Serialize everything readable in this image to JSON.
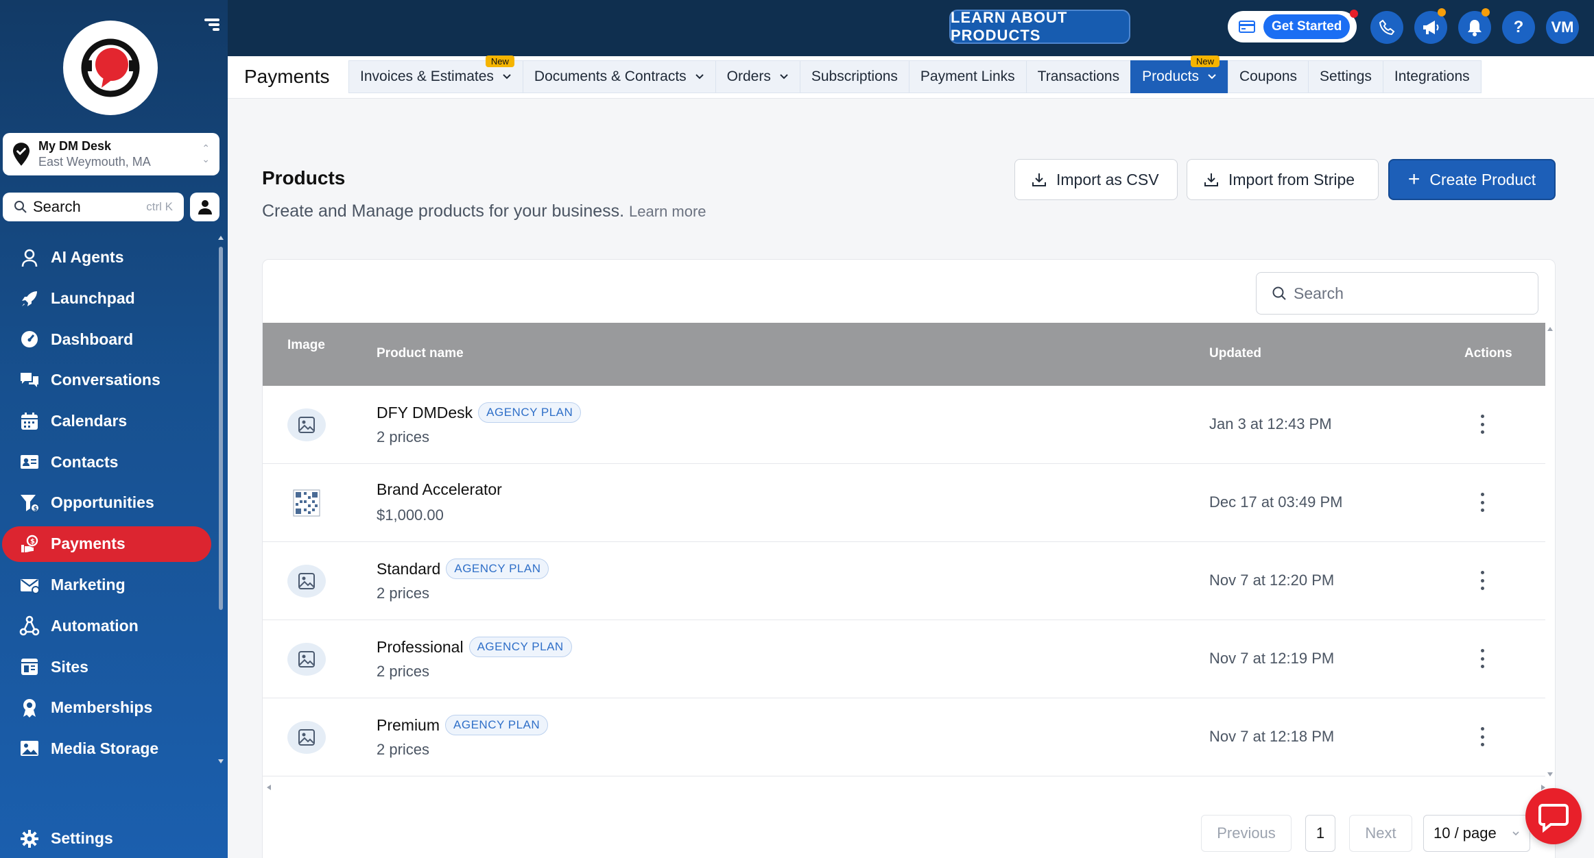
{
  "sidebar": {
    "location": {
      "name": "My DM Desk",
      "address": "East Weymouth, MA"
    },
    "search": {
      "label": "Search",
      "shortcut": "ctrl K"
    },
    "items": [
      {
        "label": "AI Agents",
        "icon": "ai-agent-icon"
      },
      {
        "label": "Launchpad",
        "icon": "rocket-icon"
      },
      {
        "label": "Dashboard",
        "icon": "gauge-icon"
      },
      {
        "label": "Conversations",
        "icon": "chat-bubbles-icon"
      },
      {
        "label": "Calendars",
        "icon": "calendar-icon"
      },
      {
        "label": "Contacts",
        "icon": "contact-card-icon"
      },
      {
        "label": "Opportunities",
        "icon": "funnel-icon"
      },
      {
        "label": "Payments",
        "icon": "payments-icon",
        "active": true
      },
      {
        "label": "Marketing",
        "icon": "envelope-icon"
      },
      {
        "label": "Automation",
        "icon": "workflow-icon"
      },
      {
        "label": "Sites",
        "icon": "sites-icon"
      },
      {
        "label": "Memberships",
        "icon": "badge-icon"
      },
      {
        "label": "Media Storage",
        "icon": "image-icon"
      }
    ],
    "settings": {
      "label": "Settings",
      "icon": "gear-icon"
    }
  },
  "topbar": {
    "learn_label": "LEARN ABOUT PRODUCTS",
    "get_started_label": "Get Started",
    "avatar_initials": "VM",
    "help_label": "?"
  },
  "subnav": {
    "title": "Payments",
    "tabs": [
      {
        "label": "Invoices & Estimates",
        "dropdown": true,
        "badge": "New"
      },
      {
        "label": "Documents & Contracts",
        "dropdown": true
      },
      {
        "label": "Orders",
        "dropdown": true
      },
      {
        "label": "Subscriptions"
      },
      {
        "label": "Payment Links"
      },
      {
        "label": "Transactions"
      },
      {
        "label": "Products",
        "dropdown": true,
        "badge": "New",
        "active": true
      },
      {
        "label": "Coupons"
      },
      {
        "label": "Settings"
      },
      {
        "label": "Integrations"
      }
    ]
  },
  "main": {
    "title": "Products",
    "subtitle": "Create and Manage products for your business.",
    "learn_more": "Learn more",
    "import_csv_label": "Import as CSV",
    "import_stripe_label": "Import from Stripe",
    "create_label": "Create Product",
    "search_placeholder": "Search",
    "table": {
      "headers": {
        "image": "Image",
        "name": "Product name",
        "updated": "Updated",
        "actions": "Actions"
      },
      "rows": [
        {
          "name": "DFY DMDesk",
          "tag": "AGENCY PLAN",
          "sub": "2 prices",
          "updated": "Jan 3 at 12:43 PM",
          "thumb": "image-placeholder"
        },
        {
          "name": "Brand Accelerator",
          "tag": "",
          "sub": "$1,000.00",
          "updated": "Dec 17 at 03:49 PM",
          "thumb": "qr-pattern"
        },
        {
          "name": "Standard",
          "tag": "AGENCY PLAN",
          "sub": "2 prices",
          "updated": "Nov 7 at 12:20 PM",
          "thumb": "image-placeholder"
        },
        {
          "name": "Professional",
          "tag": "AGENCY PLAN",
          "sub": "2 prices",
          "updated": "Nov 7 at 12:19 PM",
          "thumb": "image-placeholder"
        },
        {
          "name": "Premium",
          "tag": "AGENCY PLAN",
          "sub": "2 prices",
          "updated": "Nov 7 at 12:18 PM",
          "thumb": "image-placeholder"
        }
      ]
    },
    "pagination": {
      "previous": "Previous",
      "page": "1",
      "next": "Next",
      "page_size": "10 / page"
    }
  },
  "colors": {
    "brand_blue": "#1d5fb8",
    "active_red": "#dc2530",
    "topbar": "#0f2f4f",
    "badge_yellow": "#f5b400"
  }
}
